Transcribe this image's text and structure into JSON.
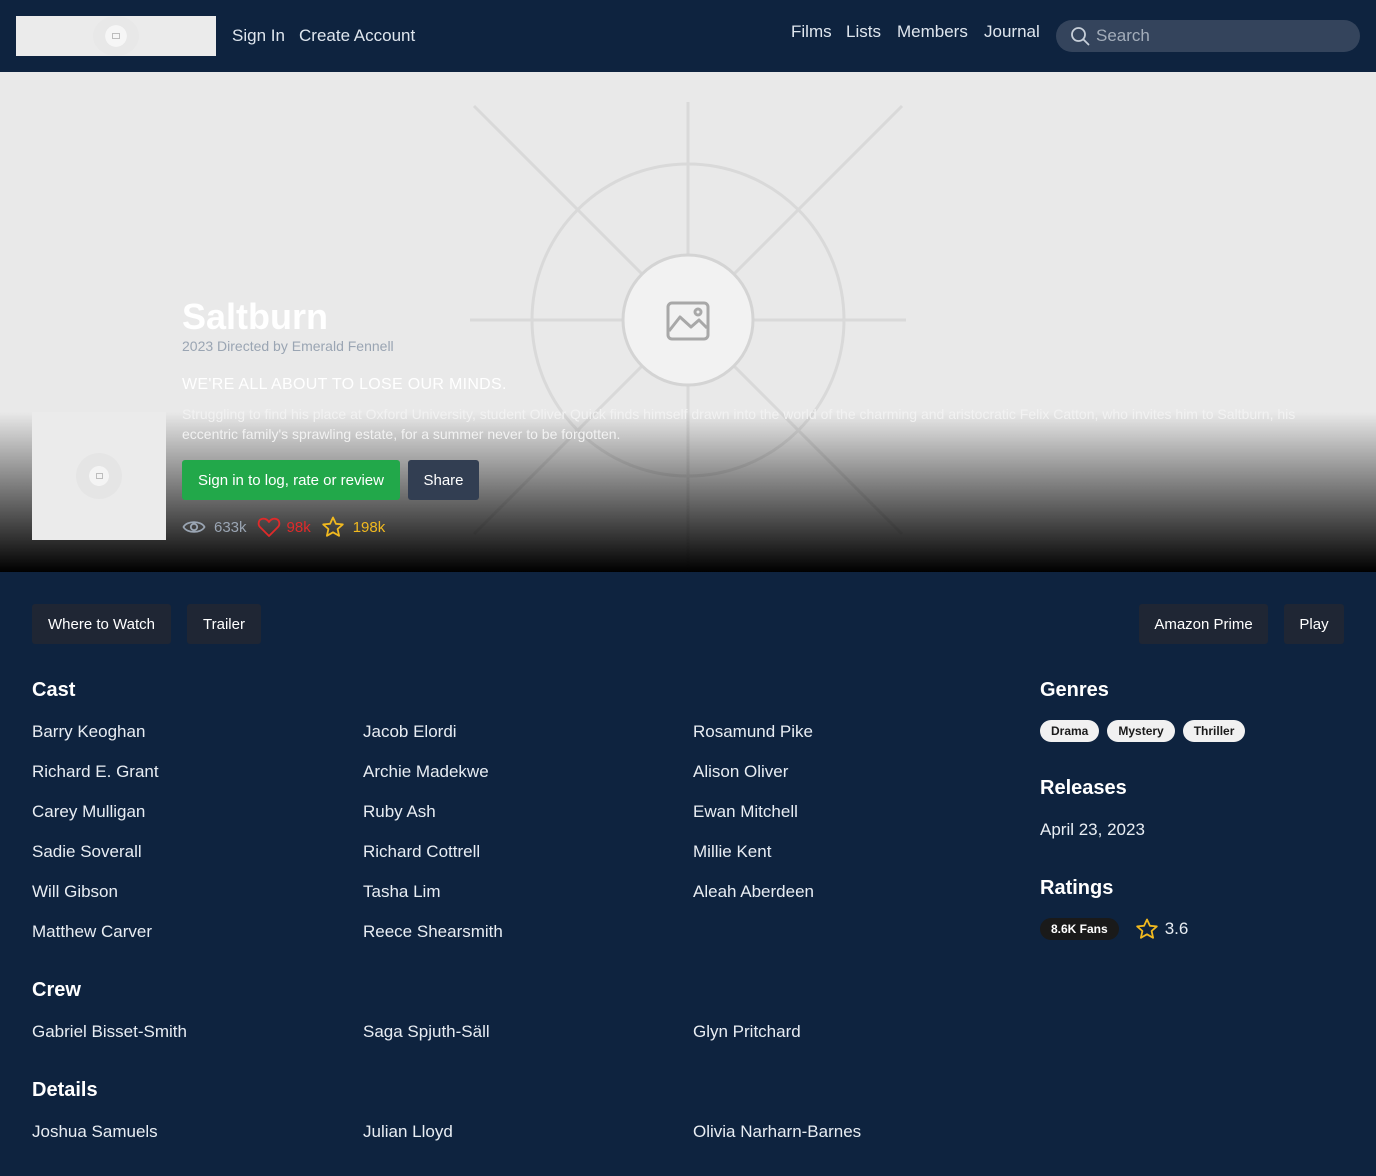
{
  "header": {
    "sign_in": "Sign In",
    "create_account": "Create Account",
    "nav": [
      "Films",
      "Lists",
      "Members",
      "Journal"
    ],
    "search_placeholder": "Search"
  },
  "film": {
    "title": "Saltburn",
    "byline": "2023 Directed by Emerald Fennell",
    "tagline": "WE'RE ALL ABOUT TO LOSE OUR MINDS.",
    "synopsis": "Struggling to find his place at Oxford University, student Oliver Quick finds himself drawn into the world of the charming and aristocratic Felix Catton, who invites him to Saltburn, his eccentric family's sprawling estate, for a summer never to be forgotten.",
    "signin_button": "Sign in to log, rate or review",
    "share_button": "Share",
    "stats": {
      "views": "633k",
      "likes": "98k",
      "lists": "198k"
    }
  },
  "actions": {
    "where_to_watch": "Where to Watch",
    "trailer": "Trailer",
    "amazon": "Amazon Prime",
    "play": "Play"
  },
  "cast": {
    "heading": "Cast",
    "names": [
      "Barry Keoghan",
      "Jacob Elordi",
      "Rosamund Pike",
      "Richard E. Grant",
      "Archie Madekwe",
      "Alison Oliver",
      "Carey Mulligan",
      "Ruby Ash",
      "Ewan Mitchell",
      "Sadie Soverall",
      "Richard Cottrell",
      "Millie Kent",
      "Will Gibson",
      "Tasha Lim",
      "Aleah Aberdeen",
      "Matthew Carver",
      "Reece Shearsmith"
    ]
  },
  "crew": {
    "heading": "Crew",
    "names": [
      "Gabriel Bisset-Smith",
      "Saga Spjuth-Säll",
      "Glyn Pritchard"
    ]
  },
  "details": {
    "heading": "Details",
    "names": [
      "Joshua Samuels",
      "Julian Lloyd",
      "Olivia Narharn-Barnes"
    ]
  },
  "genres": {
    "heading": "Genres",
    "items": [
      "Drama",
      "Mystery",
      "Thriller"
    ]
  },
  "releases": {
    "heading": "Releases",
    "date": "April 23, 2023"
  },
  "ratings": {
    "heading": "Ratings",
    "fans": "8.6K Fans",
    "average": "3.6"
  },
  "colors": {
    "background": "#0e233f",
    "accent_green": "#22a84a",
    "like_red": "#e02a2a",
    "star_yellow": "#f1b91f"
  },
  "icons": [
    "search-icon",
    "image-placeholder-icon",
    "eye-icon",
    "heart-icon",
    "star-icon"
  ]
}
